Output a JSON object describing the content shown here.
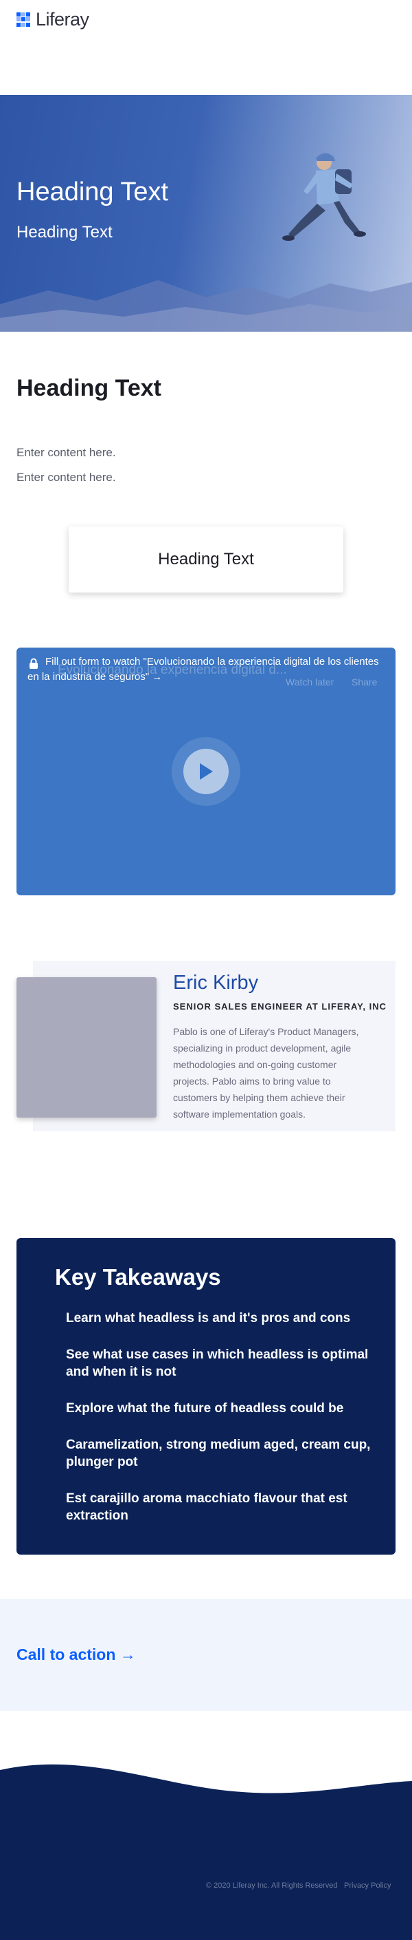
{
  "header": {
    "logo_text": "Liferay"
  },
  "hero": {
    "title": "Heading Text",
    "subtitle": "Heading Text"
  },
  "section": {
    "heading": "Heading Text",
    "paragraphs": [
      "Enter content here.",
      "Enter content here."
    ],
    "card_heading": "Heading Text"
  },
  "video": {
    "notice": "Fill out form to watch \"Evolucionando la experiencia digital de los clientes en la industria de seguros\" →",
    "ghost_title": "Evolucionando la experiencia digital d...",
    "watch_later": "Watch later",
    "share": "Share"
  },
  "speaker": {
    "name": "Eric Kirby",
    "role": "SENIOR SALES ENGINEER AT LIFERAY, INC",
    "bio": "Pablo is one of Liferay's Product Managers, specializing in product development, agile methodologies and on-going customer projects. Pablo aims to bring value to customers by helping them achieve their software implementation goals."
  },
  "takeaways": {
    "title": "Key Takeaways",
    "items": [
      "Learn what headless is and it's pros and cons",
      "See what use cases in which headless is optimal and when it is not",
      "Explore what the future of headless could be",
      "Caramelization, strong medium aged, cream cup, plunger pot",
      "Est carajillo aroma macchiato flavour that est extraction"
    ]
  },
  "cta": {
    "label": "Call to action →"
  },
  "footer": {
    "copyright": "© 2020 Liferay Inc. All Rights Reserved",
    "privacy": "Privacy Policy"
  },
  "colors": {
    "brand_blue": "#0b5fff",
    "navy": "#0c2257",
    "video_blue": "#3c76c4",
    "speaker_name": "#1d4aa6"
  }
}
